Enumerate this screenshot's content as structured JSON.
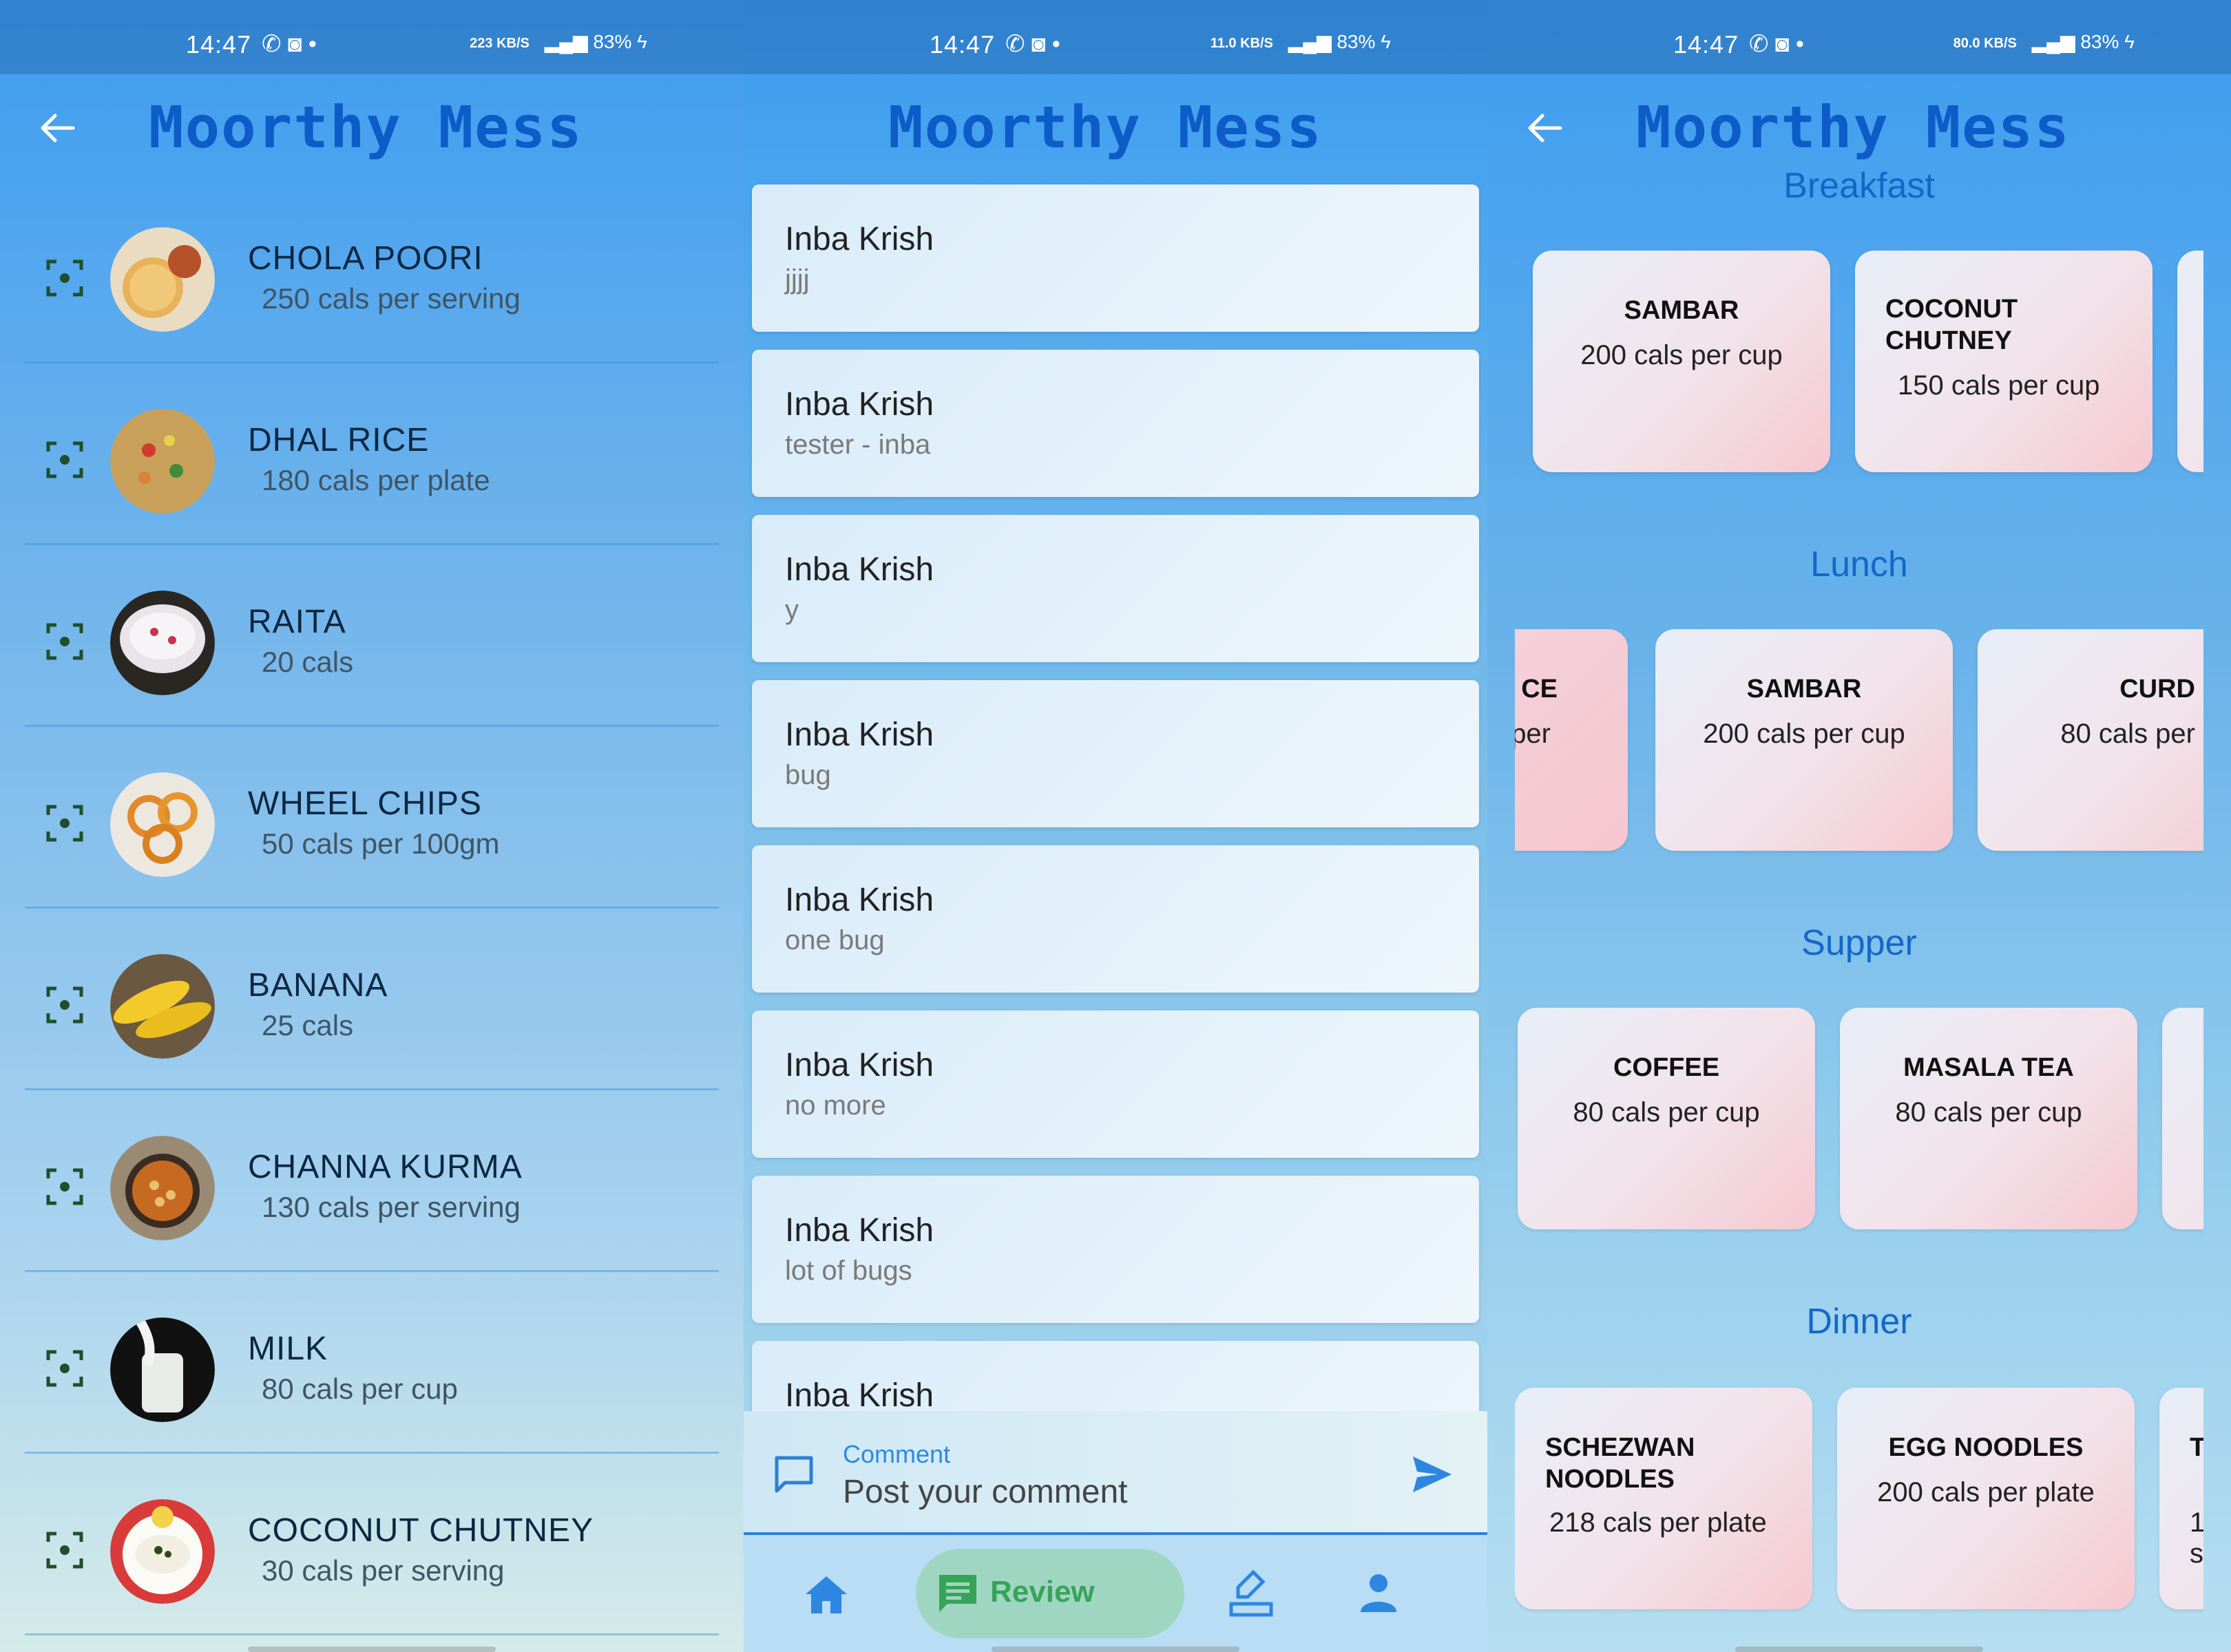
{
  "status": {
    "time": "14:47",
    "battery": "83%",
    "speeds": [
      "223 KB/S",
      "11.0 KB/S",
      "80.0 KB/S"
    ]
  },
  "app_title": "Moorthy Mess",
  "food_list": [
    {
      "name": "CHOLA POORI",
      "cal": "250 cals per serving",
      "icon": "poori-thumbnail"
    },
    {
      "name": "DHAL RICE",
      "cal": "180 cals per plate",
      "icon": "rice-thumbnail"
    },
    {
      "name": "RAITA",
      "cal": "20 cals",
      "icon": "raita-thumbnail"
    },
    {
      "name": "WHEEL CHIPS",
      "cal": "50 cals per 100gm",
      "icon": "chips-thumbnail"
    },
    {
      "name": "BANANA",
      "cal": "25 cals",
      "icon": "banana-thumbnail"
    },
    {
      "name": "CHANNA KURMA",
      "cal": "130 cals per serving",
      "icon": "kurma-thumbnail"
    },
    {
      "name": "MILK",
      "cal": "80 cals per cup",
      "icon": "milk-thumbnail"
    },
    {
      "name": "COCONUT CHUTNEY",
      "cal": "30 cals per serving",
      "icon": "chutney-thumbnail"
    }
  ],
  "reviews": [
    {
      "name": "Inba Krish",
      "text": "jjjj"
    },
    {
      "name": "Inba Krish",
      "text": "tester - inba"
    },
    {
      "name": "Inba Krish",
      "text": "y"
    },
    {
      "name": "Inba Krish",
      "text": "bug"
    },
    {
      "name": "Inba Krish",
      "text": "one bug"
    },
    {
      "name": "Inba Krish",
      "text": "no more"
    },
    {
      "name": "Inba Krish",
      "text": "lot of bugs"
    },
    {
      "name": "Inba Krish",
      "text": ""
    }
  ],
  "comment": {
    "label": "Comment",
    "placeholder": "Post your comment"
  },
  "nav": {
    "active_label": "Review",
    "items": [
      "home-icon",
      "review-icon",
      "menu-edit-icon",
      "profile-icon"
    ]
  },
  "menu": {
    "breakfast": {
      "title": "Breakfast",
      "items": [
        {
          "name": "SAMBAR",
          "cal": "200 cals per cup"
        },
        {
          "name": "COCONUT CHUTNEY",
          "cal": "150 cals per cup"
        }
      ]
    },
    "lunch": {
      "title": "Lunch",
      "items": [
        {
          "name": "CE",
          "cal": "per"
        },
        {
          "name": "SAMBAR",
          "cal": "200 cals per cup"
        },
        {
          "name": "CURD",
          "cal": "80 cals per"
        }
      ]
    },
    "supper": {
      "title": "Supper",
      "items": [
        {
          "name": "COFFEE",
          "cal": "80 cals per cup"
        },
        {
          "name": "MASALA TEA",
          "cal": "80 cals per cup"
        }
      ]
    },
    "dinner": {
      "title": "Dinner",
      "items": [
        {
          "name": "SCHEZWAN NOODLES",
          "cal": "218 cals per plate"
        },
        {
          "name": "EGG NOODLES",
          "cal": "200 cals per plate"
        },
        {
          "name": "T K",
          "cal": "1 s"
        }
      ]
    }
  },
  "colors": {
    "title": "#0e5cc8",
    "accent": "#2d8ae0",
    "nav_active": "#36a458"
  }
}
